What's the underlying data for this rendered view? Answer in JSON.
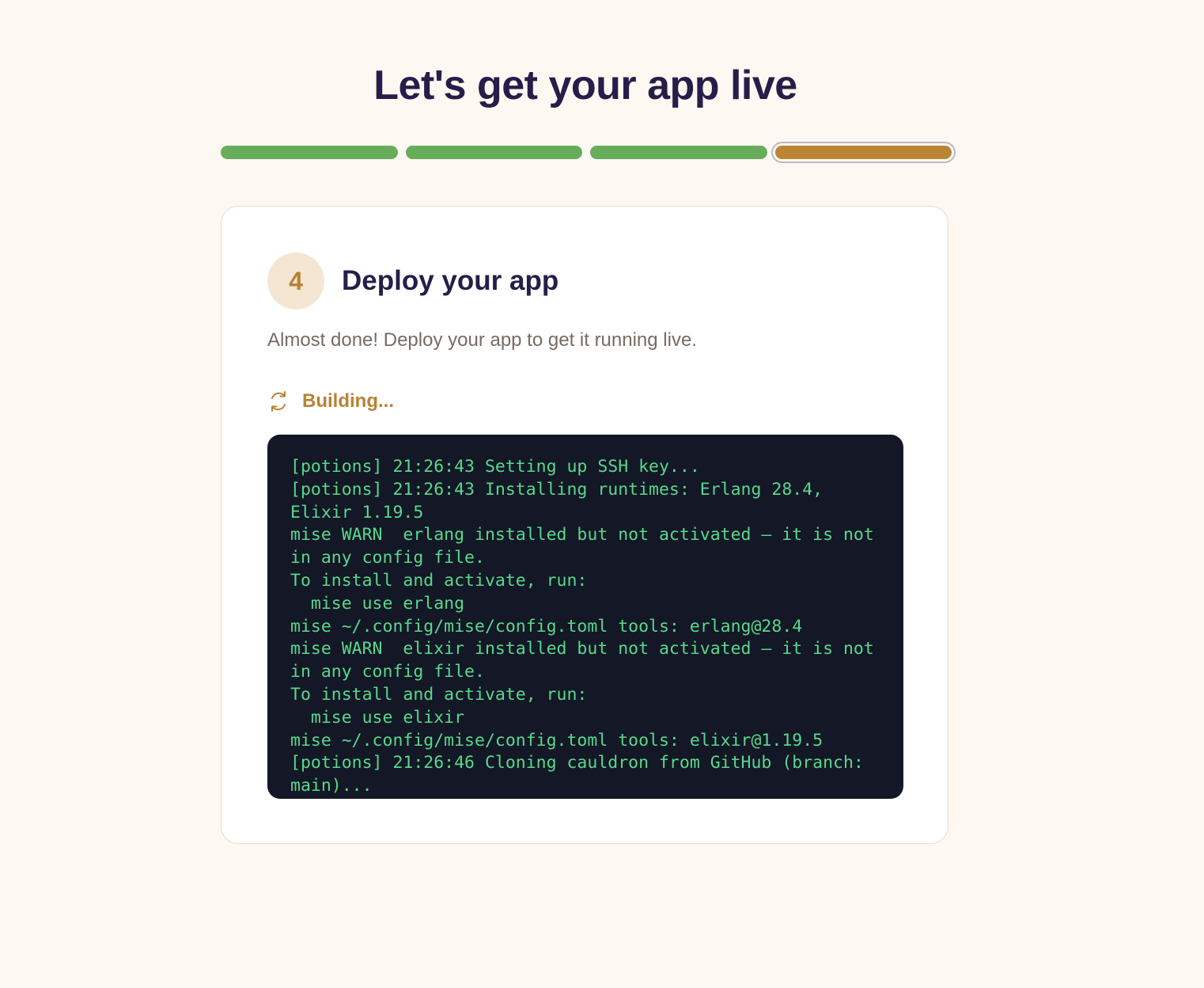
{
  "page": {
    "title": "Let's get your app live"
  },
  "progress": {
    "total_steps": 4,
    "current_step": 4,
    "steps": [
      {
        "state": "complete"
      },
      {
        "state": "complete"
      },
      {
        "state": "complete"
      },
      {
        "state": "current"
      }
    ]
  },
  "step": {
    "number": "4",
    "title": "Deploy your app",
    "description": "Almost done! Deploy your app to get it running live."
  },
  "status": {
    "icon": "refresh-icon",
    "label": "Building..."
  },
  "terminal": {
    "lines": [
      "[potions] 21:26:43 Setting up SSH key...",
      "[potions] 21:26:43 Installing runtimes: Erlang 28.4, Elixir 1.19.5",
      "mise WARN  erlang installed but not activated — it is not in any config file.",
      "To install and activate, run:",
      "  mise use erlang",
      "mise ~/.config/mise/config.toml tools: erlang@28.4",
      "mise WARN  elixir installed but not activated — it is not in any config file.",
      "To install and activate, run:",
      "  mise use elixir",
      "mise ~/.config/mise/config.toml tools: elixir@1.19.5",
      "[potions] 21:26:46 Cloning cauldron from GitHub (branch: main)..."
    ]
  },
  "colors": {
    "background": "#fdf8f2",
    "title": "#261e49",
    "complete": "#68ad5b",
    "accent": "#ba8534",
    "terminal_bg": "#131726",
    "terminal_text": "#57d98b"
  }
}
